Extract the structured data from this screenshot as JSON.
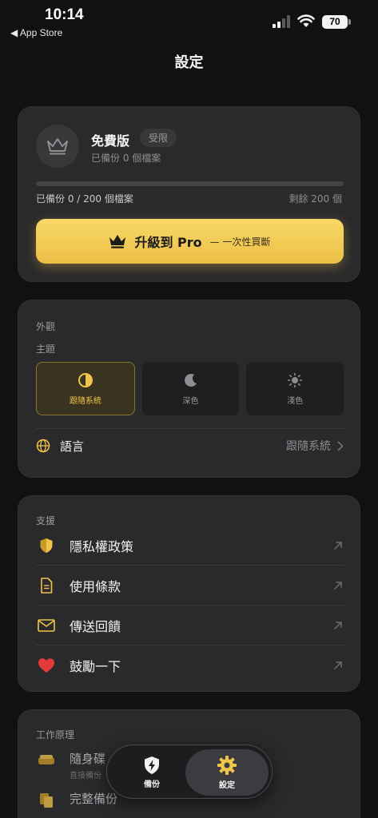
{
  "status_bar": {
    "time": "10:14",
    "back_label": "◀ App Store",
    "battery": "70"
  },
  "header": {
    "title": "設定"
  },
  "plan": {
    "name": "免費版",
    "badge": "受限",
    "subtitle": "已備份 0 個檔案",
    "progress_fraction": 0,
    "backed_up_text": "已備份  0 / 200  個檔案",
    "remaining_text": "剩餘 200 個",
    "upgrade_label": "升級到 Pro",
    "upgrade_sub": "— 一次性買斷"
  },
  "appearance": {
    "section": "外觀",
    "theme_label": "主題",
    "themes": [
      {
        "label": "跟隨系統",
        "icon": "half-circle-icon",
        "selected": true
      },
      {
        "label": "深色",
        "icon": "moon-icon",
        "selected": false
      },
      {
        "label": "淺色",
        "icon": "sun-icon",
        "selected": false
      }
    ],
    "language_label": "語言",
    "language_value": "跟隨系統"
  },
  "support": {
    "section": "支援",
    "items": [
      {
        "label": "隱私權政策",
        "icon": "shield-icon"
      },
      {
        "label": "使用條款",
        "icon": "document-icon"
      },
      {
        "label": "傳送回饋",
        "icon": "envelope-icon"
      },
      {
        "label": "鼓勵一下",
        "icon": "heart-icon"
      }
    ]
  },
  "how_it_works": {
    "section": "工作原理",
    "items": [
      {
        "title": "隨身碟",
        "desc": "直接備份",
        "icon": "drive-icon"
      },
      {
        "title": "完整備份",
        "desc": "",
        "icon": "copy-icon"
      }
    ]
  },
  "tab_bar": {
    "tabs": [
      {
        "label": "備份",
        "icon": "bolt-shield-icon"
      },
      {
        "label": "設定",
        "icon": "gear-icon"
      }
    ]
  },
  "colors": {
    "accent": "#f0c34b",
    "background": "#111112",
    "card": "#2a2a2c"
  }
}
